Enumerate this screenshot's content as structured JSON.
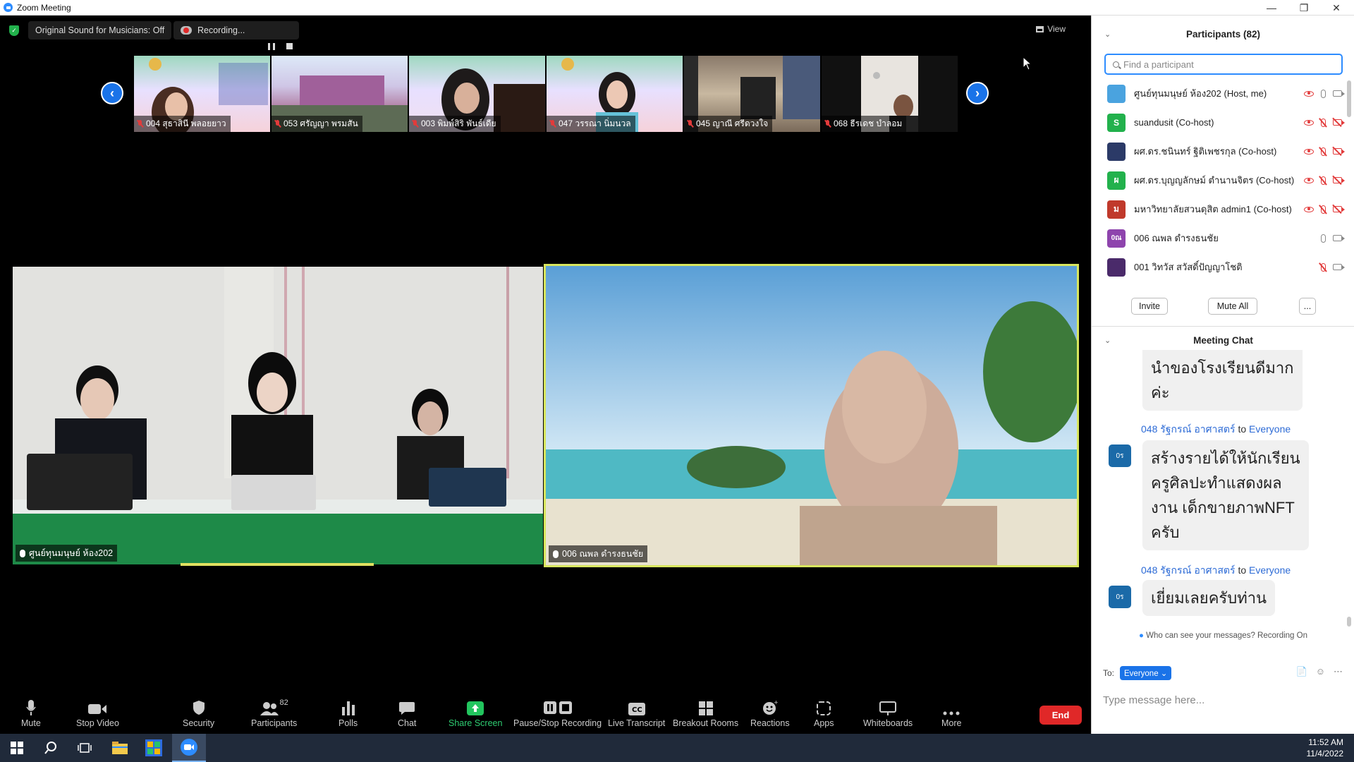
{
  "window": {
    "title": "Zoom Meeting"
  },
  "topbar": {
    "original_sound": "Original Sound for Musicians: Off",
    "recording": "Recording...",
    "view": "View"
  },
  "thumbnails": [
    {
      "name": "004 สุธาสินี พลอยยาว"
    },
    {
      "name": "053 ศรัญญา พรมสัน"
    },
    {
      "name": "003 พิมพ์สิริ พันธ์เดีย"
    },
    {
      "name": "047 วรรณา นิ่มนวล"
    },
    {
      "name": "045 ญาณี ศรีดวงใจ"
    },
    {
      "name": "068 ธีรเดช บำลอม"
    }
  ],
  "videos": {
    "left": {
      "name": "ศูนย์ทุนมนุษย์ ห้อง202"
    },
    "right": {
      "name": "006 ณพล ดำรงธนชัย"
    }
  },
  "toolbar": {
    "mute": "Mute",
    "stop_video": "Stop Video",
    "security": "Security",
    "participants": "Participants",
    "participants_count": "82",
    "polls": "Polls",
    "chat": "Chat",
    "share_screen": "Share Screen",
    "pause_stop_recording": "Pause/Stop Recording",
    "live_transcript": "Live Transcript",
    "breakout_rooms": "Breakout Rooms",
    "reactions": "Reactions",
    "apps": "Apps",
    "whiteboards": "Whiteboards",
    "more": "More",
    "end": "End"
  },
  "participants_panel": {
    "title": "Participants (82)",
    "search_placeholder": "Find a participant",
    "list": [
      {
        "name": "ศูนย์ทุนมนุษย์ ห้อง202 (Host, me)",
        "avatar": "",
        "color": "#4aa3df"
      },
      {
        "name": "suandusit (Co-host)",
        "avatar": "S",
        "color": "#22b14c"
      },
      {
        "name": "ผศ.ดร.ชนินทร์ ฐิติเพชรกุล (Co-host)",
        "avatar": "",
        "color": "#2b3a67"
      },
      {
        "name": "ผศ.ดร.บุญญลักษม์ ตำนานจิตร (Co-host)",
        "avatar": "ผ",
        "color": "#22b14c"
      },
      {
        "name": "มหาวิทยาลัยสวนดุสิต admin1 (Co-host)",
        "avatar": "ม",
        "color": "#c0392b"
      },
      {
        "name": "006 ณพล ดำรงธนชัย",
        "avatar": "0ณ",
        "color": "#8e44ad"
      },
      {
        "name": "001 วิทวัส สวัสดิ์ปัญญาโชติ",
        "avatar": "",
        "color": "#4a2a6a"
      }
    ],
    "invite": "Invite",
    "mute_all": "Mute All",
    "more": "..."
  },
  "chat_panel": {
    "title": "Meeting Chat",
    "messages": [
      {
        "sender": "",
        "to": "",
        "lines": [
          "นำของโรงเรียนดีมาก",
          "ค่ะ"
        ]
      },
      {
        "sender": "048 รัฐกรณ์ อาศาสตร์",
        "to": "Everyone",
        "lines": [
          "สร้างรายได้ให้นักเรียน",
          "ครูศิลปะทำแสดงผล",
          "งาน เด็กขายภาพNFT",
          "ครับ"
        ]
      },
      {
        "sender": "048 รัฐกรณ์ อาศาสตร์",
        "to": "Everyone",
        "lines": [
          "เยี่ยมเลยครับท่าน"
        ]
      }
    ],
    "to_word": "to",
    "avatar_label": "0ร",
    "who_can_see": "Who can see your messages? Recording On",
    "to_label": "To:",
    "to_value": "Everyone",
    "placeholder": "Type message here..."
  },
  "taskbar": {
    "time": "11:52 AM",
    "date": "11/4/2022"
  }
}
